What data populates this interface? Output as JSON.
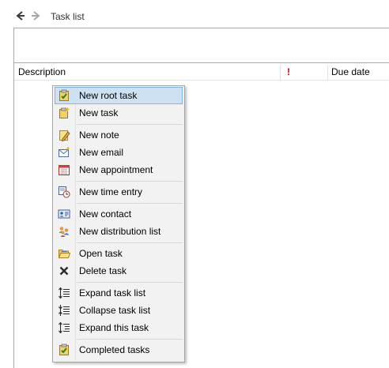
{
  "window": {
    "title": "Task list"
  },
  "list": {
    "columns": {
      "description": "Description",
      "priority": "!",
      "due_date": "Due date"
    }
  },
  "colors": {
    "highlight_bg": "#cde1f3",
    "highlight_border": "#7fb5e2",
    "priority": "#d40000"
  },
  "context_menu": {
    "items": [
      {
        "label": "New root task",
        "icon": "task-check-icon",
        "highlighted": true
      },
      {
        "label": "New task",
        "icon": "task-new-icon"
      },
      {
        "label": "New note",
        "icon": "note-pencil-icon"
      },
      {
        "label": "New email",
        "icon": "email-icon"
      },
      {
        "label": "New appointment",
        "icon": "calendar-icon"
      },
      {
        "label": "New time entry",
        "icon": "time-entry-icon"
      },
      {
        "label": "New contact",
        "icon": "contact-card-icon"
      },
      {
        "label": "New distribution list",
        "icon": "group-icon"
      },
      {
        "label": "Open task",
        "icon": "open-folder-icon"
      },
      {
        "label": "Delete task",
        "icon": "delete-x-icon"
      },
      {
        "label": "Expand task list",
        "icon": "expand-list-icon"
      },
      {
        "label": "Collapse task list",
        "icon": "collapse-list-icon"
      },
      {
        "label": "Expand this task",
        "icon": "expand-task-icon"
      },
      {
        "label": "Completed tasks",
        "icon": "completed-tasks-icon"
      }
    ]
  }
}
